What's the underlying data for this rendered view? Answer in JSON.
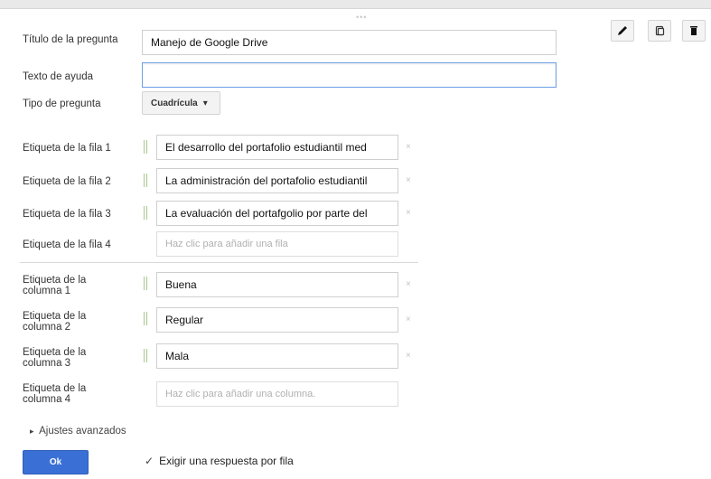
{
  "toolbar": {
    "handle": "•••",
    "edit_icon": "pencil-icon",
    "duplicate_icon": "duplicate-icon",
    "delete_icon": "trash-icon"
  },
  "question": {
    "title_label": "Título de la pregunta",
    "title_value": "Manejo de Google Drive",
    "help_label": "Texto de ayuda",
    "help_value": "",
    "type_label": "Tipo de pregunta",
    "type_value": "Cuadrícula",
    "type_arrow": "▾"
  },
  "rows": [
    {
      "label": "Etiqueta de la fila 1",
      "value": "El desarrollo  del portafolio estudiantil med"
    },
    {
      "label": "Etiqueta de la fila 2",
      "value": "La administración del portafolio estudiantil"
    },
    {
      "label": "Etiqueta de la fila 3",
      "value": "La evaluación del portafgolio por parte del"
    }
  ],
  "row_new": {
    "label": "Etiqueta de la fila 4",
    "placeholder": "Haz clic para añadir una fila"
  },
  "columns": [
    {
      "label1": "Etiqueta de la",
      "label2": "columna 1",
      "value": "Buena"
    },
    {
      "label1": "Etiqueta de la",
      "label2": "columna 2",
      "value": "Regular"
    },
    {
      "label1": "Etiqueta de la",
      "label2": "columna 3",
      "value": "Mala"
    }
  ],
  "column_new": {
    "label1": "Etiqueta de la",
    "label2": "columna 4",
    "placeholder": "Haz clic para añadir una columna."
  },
  "delete_glyph": "×",
  "advanced": {
    "arrow": "▸",
    "label": "Ajustes avanzados"
  },
  "footer": {
    "ok_label": "Ok",
    "check_mark": "✓",
    "require_label": "Exigir una respuesta por fila"
  }
}
